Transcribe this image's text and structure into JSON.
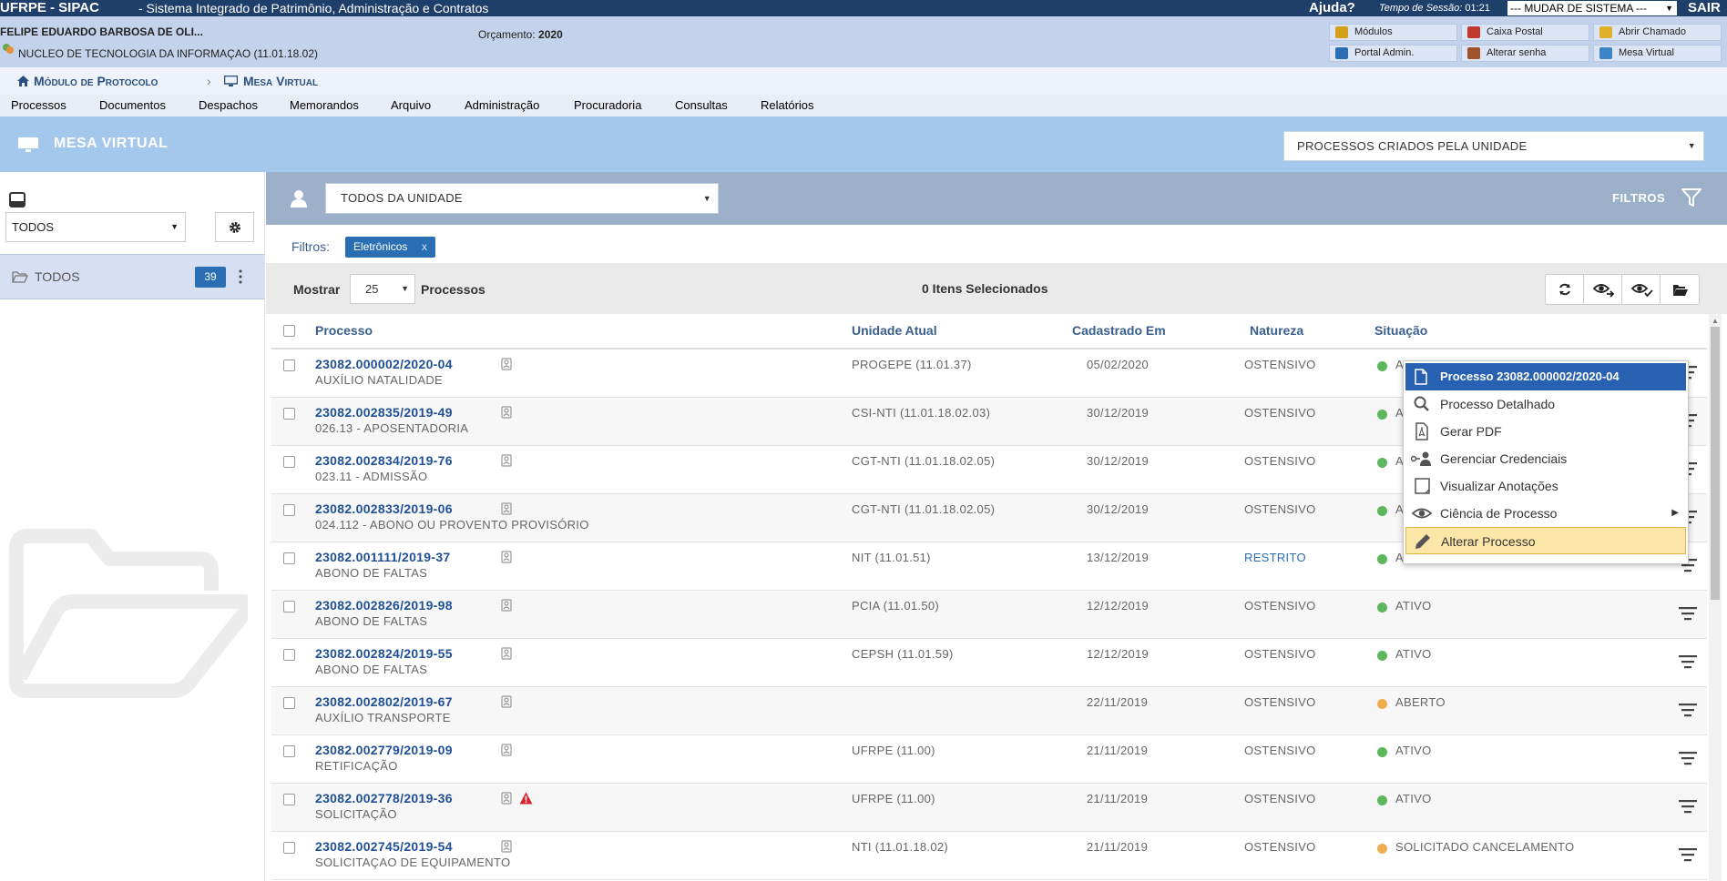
{
  "topbar": {
    "system": "UFRPE - SIPAC",
    "system_name": "- Sistema Integrado de Patrimônio, Administração e Contratos",
    "help": "Ajuda?",
    "session_label": "Tempo de Sessão:",
    "session_time": "01:21",
    "change_system": "--- MUDAR DE SISTEMA ---",
    "logout": "SAIR"
  },
  "user": {
    "name": "FELIPE EDUARDO BARBOSA DE OLI...",
    "unit": "NUCLEO DE TECNOLOGIA DA INFORMAÇAO (11.01.18.02)",
    "budget_label": "Orçamento:",
    "budget_year": "2020"
  },
  "quick_links": [
    "Módulos",
    "Caixa Postal",
    "Abrir Chamado",
    "Portal Admin.",
    "Alterar senha",
    "Mesa Virtual"
  ],
  "breadcrumb": {
    "module": "Módulo de Protocolo",
    "page": "Mesa Virtual"
  },
  "menu": [
    "Processos",
    "Documentos",
    "Despachos",
    "Memorandos",
    "Arquivo",
    "Administração",
    "Procuradoria",
    "Consultas",
    "Relatórios"
  ],
  "mesa": {
    "title": "MESA VIRTUAL",
    "scope_select": "PROCESSOS CRIADOS PELA UNIDADE"
  },
  "sidebar": {
    "filter_select": "TODOS",
    "folder_label": "TODOS",
    "folder_count": "39"
  },
  "filterbar": {
    "owner_select": "TODOS DA UNIDADE",
    "filters_label": "FILTROS"
  },
  "active_filters": {
    "label": "Filtros:",
    "chips": [
      {
        "label": "Eletrônicos",
        "remove": "x"
      }
    ]
  },
  "table_controls": {
    "show_label": "Mostrar",
    "page_size": "25",
    "items_label": "Processos",
    "selected_count": "0 Itens Selecionados"
  },
  "columns": {
    "processo": "Processo",
    "unidade": "Unidade Atual",
    "cadastrado": "Cadastrado Em",
    "natureza": "Natureza",
    "situacao": "Situação"
  },
  "rows": [
    {
      "numero": "23082.000002/2020-04",
      "assunto": "AUXÍLIO NATALIDADE",
      "unidade": "PROGEPE (11.01.37)",
      "data": "05/02/2020",
      "natureza": "OSTENSIVO",
      "situacao": "A",
      "status_color": "#5cb85c",
      "warning": false
    },
    {
      "numero": "23082.002835/2019-49",
      "assunto": "026.13 - APOSENTADORIA",
      "unidade": "CSI-NTI (11.01.18.02.03)",
      "data": "30/12/2019",
      "natureza": "OSTENSIVO",
      "situacao": "A",
      "status_color": "#5cb85c",
      "warning": false
    },
    {
      "numero": "23082.002834/2019-76",
      "assunto": "023.11 - ADMISSÃO",
      "unidade": "CGT-NTI (11.01.18.02.05)",
      "data": "30/12/2019",
      "natureza": "OSTENSIVO",
      "situacao": "A",
      "status_color": "#5cb85c",
      "warning": false
    },
    {
      "numero": "23082.002833/2019-06",
      "assunto": "024.112 - ABONO OU PROVENTO PROVISÓRIO",
      "unidade": "CGT-NTI (11.01.18.02.05)",
      "data": "30/12/2019",
      "natureza": "OSTENSIVO",
      "situacao": "A",
      "status_color": "#5cb85c",
      "warning": false
    },
    {
      "numero": "23082.001111/2019-37",
      "assunto": "ABONO DE FALTAS",
      "unidade": "NIT (11.01.51)",
      "data": "13/12/2019",
      "natureza": "RESTRITO",
      "situacao": "A",
      "status_color": "#5cb85c",
      "warning": false
    },
    {
      "numero": "23082.002826/2019-98",
      "assunto": "ABONO DE FALTAS",
      "unidade": "PCIA (11.01.50)",
      "data": "12/12/2019",
      "natureza": "OSTENSIVO",
      "situacao": "ATIVO",
      "status_color": "#5cb85c",
      "warning": false
    },
    {
      "numero": "23082.002824/2019-55",
      "assunto": "ABONO DE FALTAS",
      "unidade": "CEPSH (11.01.59)",
      "data": "12/12/2019",
      "natureza": "OSTENSIVO",
      "situacao": "ATIVO",
      "status_color": "#5cb85c",
      "warning": false
    },
    {
      "numero": "23082.002802/2019-67",
      "assunto": "AUXÍLIO TRANSPORTE",
      "unidade": "",
      "data": "22/11/2019",
      "natureza": "OSTENSIVO",
      "situacao": "ABERTO",
      "status_color": "#f0ad4e",
      "warning": false
    },
    {
      "numero": "23082.002779/2019-09",
      "assunto": "RETIFICAÇÃO",
      "unidade": "UFRPE (11.00)",
      "data": "21/11/2019",
      "natureza": "OSTENSIVO",
      "situacao": "ATIVO",
      "status_color": "#5cb85c",
      "warning": false
    },
    {
      "numero": "23082.002778/2019-36",
      "assunto": "SOLICITAÇÃO",
      "unidade": "UFRPE (11.00)",
      "data": "21/11/2019",
      "natureza": "OSTENSIVO",
      "situacao": "ATIVO",
      "status_color": "#5cb85c",
      "warning": true
    },
    {
      "numero": "23082.002745/2019-54",
      "assunto": "SOLICITAÇAO DE EQUIPAMENTO",
      "unidade": "NTI (11.01.18.02)",
      "data": "21/11/2019",
      "natureza": "OSTENSIVO",
      "situacao": "SOLICITADO CANCELAMENTO",
      "status_color": "#f0ad4e",
      "warning": false
    }
  ],
  "context_menu": {
    "title": "Processo 23082.000002/2020-04",
    "items": [
      "Processo Detalhado",
      "Gerar PDF",
      "Gerenciar Credenciais",
      "Visualizar Anotações",
      "Ciência de Processo",
      "Alterar Processo"
    ]
  },
  "icons": [
    "home-icon",
    "monitor-icon",
    "tray-icon",
    "gear-icon",
    "folder-icon",
    "person-icon",
    "funnel-icon",
    "refresh-icon",
    "eye-forward-icon",
    "eye-check-icon",
    "open-folder-icon",
    "lock-icon",
    "warning-icon",
    "row-menu-icon",
    "file-icon",
    "search-icon",
    "pdf-icon",
    "key-user-icon",
    "note-icon",
    "eye-icon",
    "pencil-icon"
  ],
  "colors": {
    "topbar": "#1f3f6b",
    "header": "#a4c7ec",
    "accent": "#2a6fb3",
    "active": "#5cb85c",
    "pending": "#f0ad4e"
  }
}
